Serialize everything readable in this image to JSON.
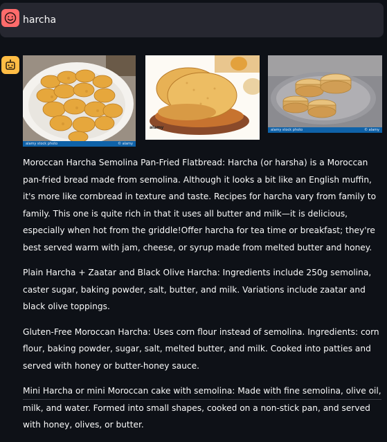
{
  "user_message": {
    "text": "harcha"
  },
  "images": [
    {
      "watermark_left": "alamy stock photo",
      "watermark_right": "© alamy"
    },
    {
      "logo": "alamy"
    },
    {
      "watermark_left": "alamy stock photo",
      "watermark_right": "© alamy"
    }
  ],
  "response": {
    "paragraphs": [
      "Moroccan Harcha Semolina Pan-Fried Flatbread: Harcha (or harsha) is a Moroccan pan-fried bread made from semolina. Although it looks a bit like an English muffin, it's more like cornbread in texture and taste. Recipes for harcha vary from family to family. This one is quite rich in that it uses all butter and milk—it is delicious, especially when hot from the griddle!Offer harcha for tea time or breakfast; they're best served warm with jam, cheese, or syrup made from melted butter and honey.",
      "Plain Harcha + Zaatar and Black Olive Harcha: Ingredients include 250g semolina, caster sugar, baking powder, salt, butter, and milk. Variations include zaatar and black olive toppings.",
      "Gluten-Free Moroccan Harcha: Uses corn flour instead of semolina. Ingredients: corn flour, baking powder, sugar, salt, melted butter, and milk. Cooked into patties and served with honey or butter-honey sauce.",
      "Mini Harcha or mini Moroccan cake with semolina: Made with fine semolina, olive oil, milk, and water. Formed into small shapes, cooked on a non-stick pan, and served with honey, olives, or butter."
    ]
  },
  "colors": {
    "background": "#0e1117",
    "user_bubble": "#262730",
    "user_avatar": "#ff6b6b",
    "assistant_avatar": "#ffbd45"
  },
  "icons": {
    "user_avatar": "smiley-face-icon",
    "assistant_avatar": "robot-face-icon"
  }
}
